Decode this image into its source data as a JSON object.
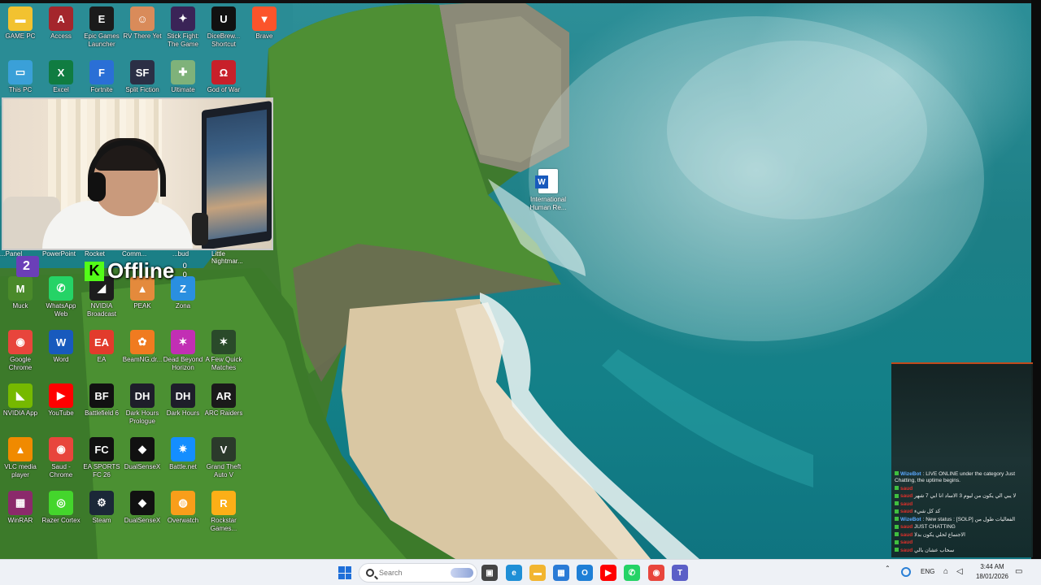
{
  "desktop_icons": [
    {
      "id": "game-pc",
      "label": "GAME PC",
      "icon": "folder-icon",
      "color": "#f2c230"
    },
    {
      "id": "access",
      "label": "Access",
      "icon": "access-icon",
      "color": "#a4262c"
    },
    {
      "id": "epic",
      "label": "Epic Games Launcher",
      "icon": "epic-games-icon",
      "color": "#1b1b1b"
    },
    {
      "id": "rv-there-yet",
      "label": "RV There Yet",
      "icon": "rv-there-yet-icon",
      "color": "#d98b5a"
    },
    {
      "id": "stick-fight",
      "label": "Stick Fight: The Game",
      "icon": "stick-fight-icon",
      "color": "#3a2457"
    },
    {
      "id": "unreal",
      "label": "DiceBrew... Shortcut",
      "icon": "unreal-engine-icon",
      "color": "#111111"
    },
    {
      "id": "brave",
      "label": "Brave",
      "icon": "brave-icon",
      "color": "#fb542b"
    },
    {
      "id": "this-pc",
      "label": "This PC",
      "icon": "monitor-icon",
      "color": "#3aa0d8"
    },
    {
      "id": "excel",
      "label": "Excel",
      "icon": "excel-icon",
      "color": "#107c41"
    },
    {
      "id": "fortnite",
      "label": "Fortnite",
      "icon": "fortnite-icon",
      "color": "#2a6fd6"
    },
    {
      "id": "split-fiction",
      "label": "Split Fiction",
      "icon": "split-fiction-icon",
      "color": "#2b2f45"
    },
    {
      "id": "ultimate",
      "label": "Ultimate",
      "icon": "ultimate-icon",
      "color": "#7fb27a"
    },
    {
      "id": "god-of-war",
      "label": "God of War",
      "icon": "god-of-war-icon",
      "color": "#c8202a"
    },
    {
      "id": "muck",
      "label": "Muck",
      "icon": "muck-icon",
      "color": "#4a8a2a"
    },
    {
      "id": "whatsapp",
      "label": "WhatsApp Web",
      "icon": "whatsapp-icon",
      "color": "#25d366"
    },
    {
      "id": "nvidia-broadcast",
      "label": "NVIDIA Broadcast",
      "icon": "nvidia-broadcast-icon",
      "color": "#1d1d1d"
    },
    {
      "id": "peak",
      "label": "PEAK",
      "icon": "peak-icon",
      "color": "#e48a3c"
    },
    {
      "id": "zona",
      "label": "Zona",
      "icon": "zona-icon",
      "color": "#2a8fe0"
    },
    {
      "id": "chrome",
      "label": "Google Chrome",
      "icon": "chrome-icon",
      "color": "#e8453c"
    },
    {
      "id": "word",
      "label": "Word",
      "icon": "word-icon",
      "color": "#185abd"
    },
    {
      "id": "ea",
      "label": "EA",
      "icon": "ea-icon",
      "color": "#e23b2c"
    },
    {
      "id": "beamng",
      "label": "BeamNG.dr...",
      "icon": "beamng-icon",
      "color": "#f07b20"
    },
    {
      "id": "dead-by",
      "label": "Dead Beyond Horizon",
      "icon": "game-icon",
      "color": "#c22fb4"
    },
    {
      "id": "quick-matches",
      "label": "A Few Quick Matches",
      "icon": "game-icon",
      "color": "#2a4a2a"
    },
    {
      "id": "nvidia-app",
      "label": "NVIDIA App",
      "icon": "nvidia-icon",
      "color": "#76b900"
    },
    {
      "id": "youtube",
      "label": "YouTube",
      "icon": "youtube-icon",
      "color": "#ff0000"
    },
    {
      "id": "battlefield",
      "label": "Battlefield 6",
      "icon": "battlefield-icon",
      "color": "#111111"
    },
    {
      "id": "dark-hours-1",
      "label": "Dark Hours Prologue",
      "icon": "dark-hours-icon",
      "color": "#1e1e2a"
    },
    {
      "id": "dark-hours-2",
      "label": "Dark Hours",
      "icon": "dark-hours-icon",
      "color": "#1e1e2a"
    },
    {
      "id": "arc-raiders",
      "label": "ARC Raiders",
      "icon": "arc-raiders-icon",
      "color": "#1a1a1a"
    },
    {
      "id": "vlc",
      "label": "VLC media player",
      "icon": "vlc-icon",
      "color": "#f08a00"
    },
    {
      "id": "chrome-2",
      "label": "Saud - Chrome",
      "icon": "chrome-profile-icon",
      "color": "#e8453c"
    },
    {
      "id": "fc26",
      "label": "EA SPORTS FC 26",
      "icon": "fc26-icon",
      "color": "#111111"
    },
    {
      "id": "dualsensex",
      "label": "DualSenseX",
      "icon": "dualsensex-icon",
      "color": "#111111"
    },
    {
      "id": "battle-net",
      "label": "Battle.net",
      "icon": "battle-net-icon",
      "color": "#148eff"
    },
    {
      "id": "gta",
      "label": "Grand Theft Auto V",
      "icon": "gta-icon",
      "color": "#2b3a2b"
    },
    {
      "id": "winrar",
      "label": "WinRAR",
      "icon": "winrar-icon",
      "color": "#8b2a6b"
    },
    {
      "id": "razer",
      "label": "Razer Cortex",
      "icon": "razer-icon",
      "color": "#44d62c"
    },
    {
      "id": "steam",
      "label": "Steam",
      "icon": "steam-icon",
      "color": "#1b2838"
    },
    {
      "id": "dualsensex-2",
      "label": "DualSenseX",
      "icon": "dualsensex-icon",
      "color": "#111111"
    },
    {
      "id": "overwatch",
      "label": "Overwatch",
      "icon": "overwatch-icon",
      "color": "#f99e1a"
    },
    {
      "id": "rockstar",
      "label": "Rockstar Games...",
      "icon": "rockstar-icon",
      "color": "#fcaf17"
    }
  ],
  "cut_labels": [
    "...Panel",
    "PowerPoint",
    "Rocket",
    "Comm...",
    "...bud",
    "Little Nightmar..."
  ],
  "overlay": {
    "status_text": "Offline",
    "kick_letter": "K",
    "viewer_count": "0",
    "follower_count": "0",
    "twitch_number": "2"
  },
  "desktop_file": {
    "label": "International Human Re..."
  },
  "chat": {
    "messages": [
      {
        "user": "WizeBot",
        "user_color": "blue",
        "text": ": LIVE ONLINE under the category Just Chatting, the uptime begins."
      },
      {
        "user": "saud",
        "user_color": "red",
        "text": ""
      },
      {
        "user": "saud",
        "user_color": "red",
        "text": "لا يبي الي يكون من ليوم 3 الاساد انا ابي 7 شهر"
      },
      {
        "user": "saud",
        "user_color": "red",
        "text": ""
      },
      {
        "user": "saud",
        "user_color": "red",
        "text": "كد كل شيء"
      },
      {
        "user": "WizeBot",
        "user_color": "blue",
        "text": ": New status : [SOLP] الفعاليات طول من"
      },
      {
        "user": "saud",
        "user_color": "red",
        "text": "JUST CHATTING"
      },
      {
        "user": "saud",
        "user_color": "red",
        "text": "الاجتماع لحلي يكون بدلا"
      },
      {
        "user": "saud",
        "user_color": "red",
        "text": ""
      },
      {
        "user": "saud",
        "user_color": "red",
        "text": "سحاب عشان بالي"
      }
    ]
  },
  "taskbar": {
    "search_placeholder": "Search",
    "apps": [
      {
        "name": "task-view-icon",
        "glyph": "▣",
        "color": "#444444"
      },
      {
        "name": "edge-icon",
        "glyph": "e",
        "color": "#1f8fd6"
      },
      {
        "name": "file-explorer-icon",
        "glyph": "▬",
        "color": "#f2b530"
      },
      {
        "name": "microsoft-store-icon",
        "glyph": "▦",
        "color": "#2b7bd6"
      },
      {
        "name": "outlook-icon",
        "glyph": "O",
        "color": "#1f7fd6"
      },
      {
        "name": "youtube-icon",
        "glyph": "▶",
        "color": "#ff0000"
      },
      {
        "name": "whatsapp-icon",
        "glyph": "✆",
        "color": "#25d366"
      },
      {
        "name": "chrome-icon",
        "glyph": "◉",
        "color": "#e8453c"
      },
      {
        "name": "teams-icon",
        "glyph": "T",
        "color": "#5b5fc7"
      }
    ],
    "tray": {
      "language": "ENG"
    },
    "clock": {
      "time": "3:44 AM",
      "date": "18/01/2026"
    }
  }
}
